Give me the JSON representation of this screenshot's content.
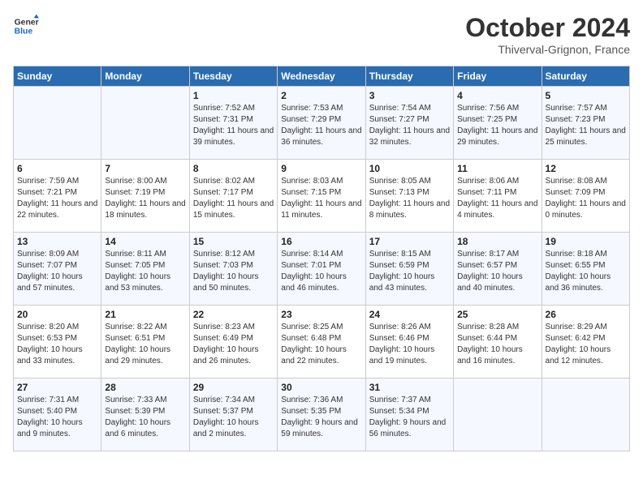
{
  "header": {
    "logo_line1": "General",
    "logo_line2": "Blue",
    "month": "October 2024",
    "location": "Thiverval-Grignon, France"
  },
  "weekdays": [
    "Sunday",
    "Monday",
    "Tuesday",
    "Wednesday",
    "Thursday",
    "Friday",
    "Saturday"
  ],
  "weeks": [
    [
      {
        "day": "",
        "info": ""
      },
      {
        "day": "",
        "info": ""
      },
      {
        "day": "1",
        "info": "Sunrise: 7:52 AM\nSunset: 7:31 PM\nDaylight: 11 hours and 39 minutes."
      },
      {
        "day": "2",
        "info": "Sunrise: 7:53 AM\nSunset: 7:29 PM\nDaylight: 11 hours and 36 minutes."
      },
      {
        "day": "3",
        "info": "Sunrise: 7:54 AM\nSunset: 7:27 PM\nDaylight: 11 hours and 32 minutes."
      },
      {
        "day": "4",
        "info": "Sunrise: 7:56 AM\nSunset: 7:25 PM\nDaylight: 11 hours and 29 minutes."
      },
      {
        "day": "5",
        "info": "Sunrise: 7:57 AM\nSunset: 7:23 PM\nDaylight: 11 hours and 25 minutes."
      }
    ],
    [
      {
        "day": "6",
        "info": "Sunrise: 7:59 AM\nSunset: 7:21 PM\nDaylight: 11 hours and 22 minutes."
      },
      {
        "day": "7",
        "info": "Sunrise: 8:00 AM\nSunset: 7:19 PM\nDaylight: 11 hours and 18 minutes."
      },
      {
        "day": "8",
        "info": "Sunrise: 8:02 AM\nSunset: 7:17 PM\nDaylight: 11 hours and 15 minutes."
      },
      {
        "day": "9",
        "info": "Sunrise: 8:03 AM\nSunset: 7:15 PM\nDaylight: 11 hours and 11 minutes."
      },
      {
        "day": "10",
        "info": "Sunrise: 8:05 AM\nSunset: 7:13 PM\nDaylight: 11 hours and 8 minutes."
      },
      {
        "day": "11",
        "info": "Sunrise: 8:06 AM\nSunset: 7:11 PM\nDaylight: 11 hours and 4 minutes."
      },
      {
        "day": "12",
        "info": "Sunrise: 8:08 AM\nSunset: 7:09 PM\nDaylight: 11 hours and 0 minutes."
      }
    ],
    [
      {
        "day": "13",
        "info": "Sunrise: 8:09 AM\nSunset: 7:07 PM\nDaylight: 10 hours and 57 minutes."
      },
      {
        "day": "14",
        "info": "Sunrise: 8:11 AM\nSunset: 7:05 PM\nDaylight: 10 hours and 53 minutes."
      },
      {
        "day": "15",
        "info": "Sunrise: 8:12 AM\nSunset: 7:03 PM\nDaylight: 10 hours and 50 minutes."
      },
      {
        "day": "16",
        "info": "Sunrise: 8:14 AM\nSunset: 7:01 PM\nDaylight: 10 hours and 46 minutes."
      },
      {
        "day": "17",
        "info": "Sunrise: 8:15 AM\nSunset: 6:59 PM\nDaylight: 10 hours and 43 minutes."
      },
      {
        "day": "18",
        "info": "Sunrise: 8:17 AM\nSunset: 6:57 PM\nDaylight: 10 hours and 40 minutes."
      },
      {
        "day": "19",
        "info": "Sunrise: 8:18 AM\nSunset: 6:55 PM\nDaylight: 10 hours and 36 minutes."
      }
    ],
    [
      {
        "day": "20",
        "info": "Sunrise: 8:20 AM\nSunset: 6:53 PM\nDaylight: 10 hours and 33 minutes."
      },
      {
        "day": "21",
        "info": "Sunrise: 8:22 AM\nSunset: 6:51 PM\nDaylight: 10 hours and 29 minutes."
      },
      {
        "day": "22",
        "info": "Sunrise: 8:23 AM\nSunset: 6:49 PM\nDaylight: 10 hours and 26 minutes."
      },
      {
        "day": "23",
        "info": "Sunrise: 8:25 AM\nSunset: 6:48 PM\nDaylight: 10 hours and 22 minutes."
      },
      {
        "day": "24",
        "info": "Sunrise: 8:26 AM\nSunset: 6:46 PM\nDaylight: 10 hours and 19 minutes."
      },
      {
        "day": "25",
        "info": "Sunrise: 8:28 AM\nSunset: 6:44 PM\nDaylight: 10 hours and 16 minutes."
      },
      {
        "day": "26",
        "info": "Sunrise: 8:29 AM\nSunset: 6:42 PM\nDaylight: 10 hours and 12 minutes."
      }
    ],
    [
      {
        "day": "27",
        "info": "Sunrise: 7:31 AM\nSunset: 5:40 PM\nDaylight: 10 hours and 9 minutes."
      },
      {
        "day": "28",
        "info": "Sunrise: 7:33 AM\nSunset: 5:39 PM\nDaylight: 10 hours and 6 minutes."
      },
      {
        "day": "29",
        "info": "Sunrise: 7:34 AM\nSunset: 5:37 PM\nDaylight: 10 hours and 2 minutes."
      },
      {
        "day": "30",
        "info": "Sunrise: 7:36 AM\nSunset: 5:35 PM\nDaylight: 9 hours and 59 minutes."
      },
      {
        "day": "31",
        "info": "Sunrise: 7:37 AM\nSunset: 5:34 PM\nDaylight: 9 hours and 56 minutes."
      },
      {
        "day": "",
        "info": ""
      },
      {
        "day": "",
        "info": ""
      }
    ]
  ]
}
